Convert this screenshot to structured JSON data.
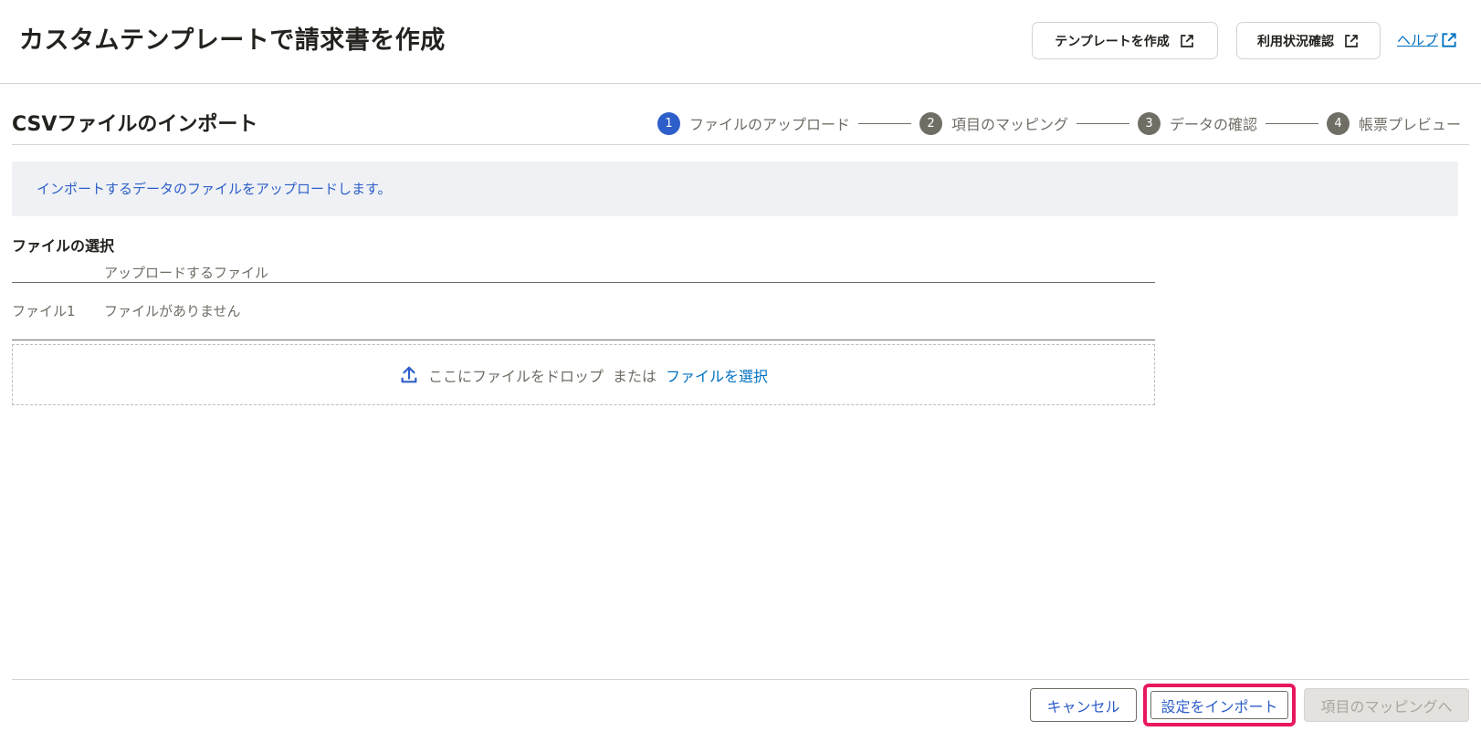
{
  "header": {
    "title": "カスタムテンプレートで請求書を作成",
    "create_template_label": "テンプレートを作成",
    "usage_label": "利用状況確認",
    "help_label": "ヘルプ"
  },
  "section": {
    "title": "CSVファイルのインポート"
  },
  "stepper": {
    "steps": [
      {
        "number": "1",
        "label": "ファイルのアップロード",
        "active": true
      },
      {
        "number": "2",
        "label": "項目のマッピング",
        "active": false
      },
      {
        "number": "3",
        "label": "データの確認",
        "active": false
      },
      {
        "number": "4",
        "label": "帳票プレビュー",
        "active": false
      }
    ]
  },
  "info": {
    "message": "インポートするデータのファイルをアップロードします。"
  },
  "file_select": {
    "heading": "ファイルの選択",
    "column_header": "アップロードするファイル",
    "rows": [
      {
        "label": "ファイル1",
        "value": "ファイルがありません"
      }
    ]
  },
  "dropzone": {
    "drop_text": "ここにファイルをドロップ",
    "or_text": "または",
    "select_link": "ファイルを選択"
  },
  "footer": {
    "cancel_label": "キャンセル",
    "import_settings_label": "設定をインポート",
    "next_label": "項目のマッピングへ"
  },
  "colors": {
    "primary": "#2d5ec9",
    "link": "#0071c1",
    "highlight": "#e8175d",
    "info_bg": "#eff1f4"
  }
}
